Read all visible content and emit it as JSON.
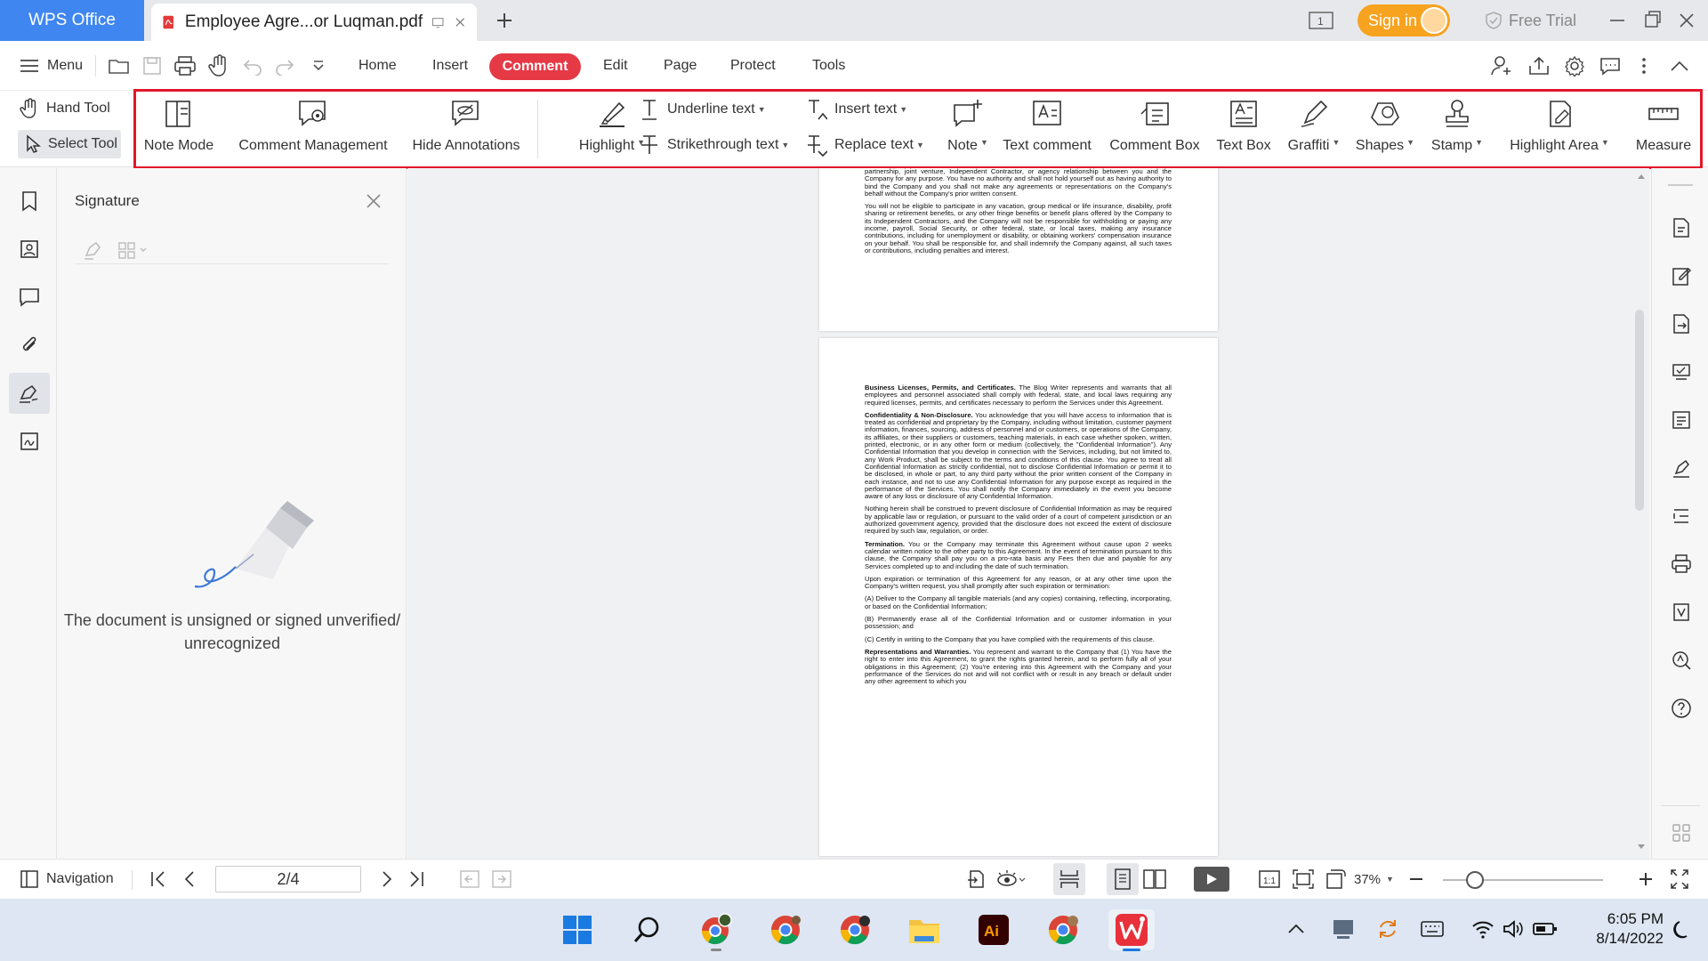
{
  "titlebar": {
    "brand": "WPS Office",
    "doc_tab_title": "Employee Agre...or Luqman.pdf",
    "signin_label": "Sign in",
    "free_trial_label": "Free Trial",
    "page_badge": "1"
  },
  "menubar": {
    "menu_label": "Menu",
    "tabs": [
      "Home",
      "Insert",
      "Comment",
      "Edit",
      "Page",
      "Protect",
      "Tools"
    ],
    "active_tab": "Comment"
  },
  "ribbon": {
    "hand_tool": "Hand Tool",
    "select_tool": "Select Tool",
    "note_mode": "Note Mode",
    "comment_management": "Comment Management",
    "hide_annotations": "Hide Annotations",
    "highlight": "Highlight",
    "underline_text": "Underline text",
    "strikethrough_text": "Strikethrough text",
    "insert_text": "Insert text",
    "replace_text": "Replace text",
    "note": "Note",
    "text_comment": "Text comment",
    "comment_box": "Comment Box",
    "text_box": "Text Box",
    "graffiti": "Graffiti",
    "shapes": "Shapes",
    "stamp": "Stamp",
    "highlight_area": "Highlight Area",
    "measure": "Measure"
  },
  "signature_panel": {
    "title": "Signature",
    "message": "The document is unsigned or signed unverified/ unrecognized"
  },
  "document": {
    "page1_paragraphs": [
      "partnership, joint venture, Independent Contractor, or agency relationship between you and the Company for any purpose. You have no authority and shall not hold yourself out as having authority to bind the Company and you shall not make any agreements or representations on the Company's behalf without the Company's prior written consent.",
      "You will not be eligible to participate in any vacation, group medical or life insurance, disability, profit sharing or retirement benefits, or any other fringe benefits or benefit plans offered by the Company to its Independent Contractors, and the Company will not be responsible for withholding or paying any income, payroll, Social Security, or other federal, state, or local taxes, making any insurance contributions, including for unemployment or disability, or obtaining workers' compensation insurance on your behalf. You shall be responsible for, and shall indemnify the Company against, all such taxes or contributions, including penalties and interest."
    ],
    "page2_paragraphs": [
      {
        "heading": "Business Licenses, Permits, and Certificates.",
        "text": " The Blog Writer represents and warrants that all employees and personnel associated shall comply with federal, state, and local laws requiring any required licenses, permits, and certificates necessary to perform the Services under this Agreement."
      },
      {
        "heading": "Confidentiality & Non-Disclosure.",
        "text": " You acknowledge that you will have access to information that is treated as confidential and proprietary by the Company, including without limitation, customer payment information, finances, sourcing, address of personnel and or customers, or operations of the Company, its affiliates, or their suppliers or customers, teaching materials, in each case whether spoken, written, printed, electronic, or in any other form or medium (collectively, the \"Confidential Information\"). Any Confidential Information that you develop in connection with the Services, including, but not limited to, any Work Product, shall be subject to the terms and conditions of this clause. You agree to treat all Confidential Information as strictly confidential, not to disclose Confidential Information or permit it to be disclosed, in whole or part, to any third party without the prior written consent of the Company in each instance, and not to use any Confidential Information for any purpose except as required in the performance of the Services. You shall notify the Company immediately in the event you become aware of any loss or disclosure of any Confidential Information."
      },
      {
        "heading": "",
        "text": "Nothing herein shall be construed to prevent disclosure of Confidential Information as may be required by applicable law or regulation, or pursuant to the valid order of a court of competent jurisdiction or an authorized government agency, provided that the disclosure does not exceed the extent of disclosure required by such law, regulation, or order."
      },
      {
        "heading": "Termination.",
        "text": " You or the Company may terminate this Agreement without cause upon 2 weeks calendar written notice to the other party to this Agreement. In the event of termination pursuant to this clause, the Company shall pay you on a pro-rata basis any Fees then due and payable for any Services completed up to and including the date of such termination."
      },
      {
        "heading": "",
        "text": "Upon expiration or termination of this Agreement for any reason, or at any other time upon the Company's written request, you shall promptly after such expiration or termination:"
      },
      {
        "heading": "",
        "text": "(A)    Deliver to the Company all tangible materials (and any copies) containing, reflecting, incorporating, or based on the Confidential Information;"
      },
      {
        "heading": "",
        "text": "(B) Permanently erase all of the Confidential Information and or customer information in your possession; and"
      },
      {
        "heading": "",
        "text": "(C)    Certify in writing to the Company that you have complied with the requirements of this clause."
      },
      {
        "heading": "Representations and Warranties.",
        "text": " You represent and warrant to the Company that (1) You have the right to enter into this Agreement, to grant the rights granted herein, and to perform fully all of your obligations in this Agreement; (2) You're entering into this Agreement with the Company and your performance of the Services do not and will not conflict with or result in any breach or default under any other agreement to which you"
      }
    ]
  },
  "statusbar": {
    "navigation_label": "Navigation",
    "page_indicator": "2/4",
    "zoom": "37%",
    "zoom_level_fraction": 0.2
  },
  "taskbar": {
    "time": "6:05 PM",
    "date": "8/14/2022"
  },
  "colors": {
    "accent_red": "#e63946",
    "brand_blue": "#3f86f0",
    "signin_orange": "#f7a320",
    "highlight_frame": "#e0182a"
  }
}
